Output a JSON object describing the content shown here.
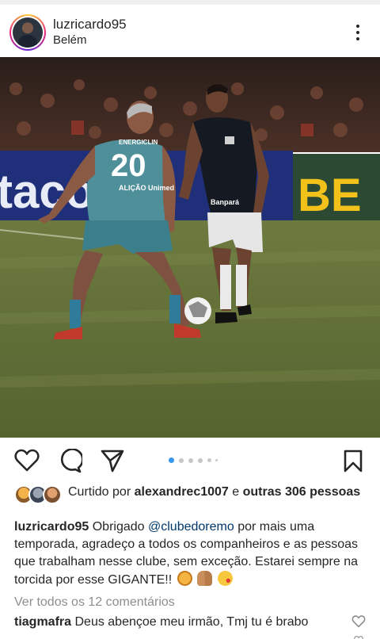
{
  "post": {
    "username": "luzricardo95",
    "location": "Belém",
    "carousel": {
      "total": 6,
      "current": 1
    },
    "liked_by": {
      "prefix": "Curtido por",
      "user": "alexandrec1007",
      "joiner": "e",
      "others": "outras 306",
      "suffix": "pessoas"
    },
    "caption": {
      "username": "luzricardo95",
      "text_1": "Obrigado",
      "mention": "@clubedoremo",
      "text_2": "por mais uma temporada, agradeço a todos os companheiros e as pessoas que trabalham nesse clube, sem exceção. Estarei sempre na torcida por esse GIGANTE!!"
    },
    "view_all_comments": "Ver todos os 12 comentários",
    "top_comment": {
      "username": "tiagmafra",
      "text": "Deus abençoe meu irmão, Tmj tu é brabo"
    }
  },
  "photo": {
    "ad_board_text_left": "tacon",
    "ad_board_text_right": "BE",
    "player_left_number": "20",
    "player_left_sponsor": "ENERGICLIN",
    "player_left_sponsor_2": "ALIÇÃO\nUnimed",
    "player_right_sponsor": "Banpará"
  },
  "icons": [
    "heart-icon",
    "comment-icon",
    "share-icon",
    "bookmark-icon",
    "more-options-icon"
  ],
  "colors": {
    "text": "#262626",
    "secondary": "#8e8e8e",
    "mention": "#00376b",
    "carousel_active": "#3897f0"
  }
}
